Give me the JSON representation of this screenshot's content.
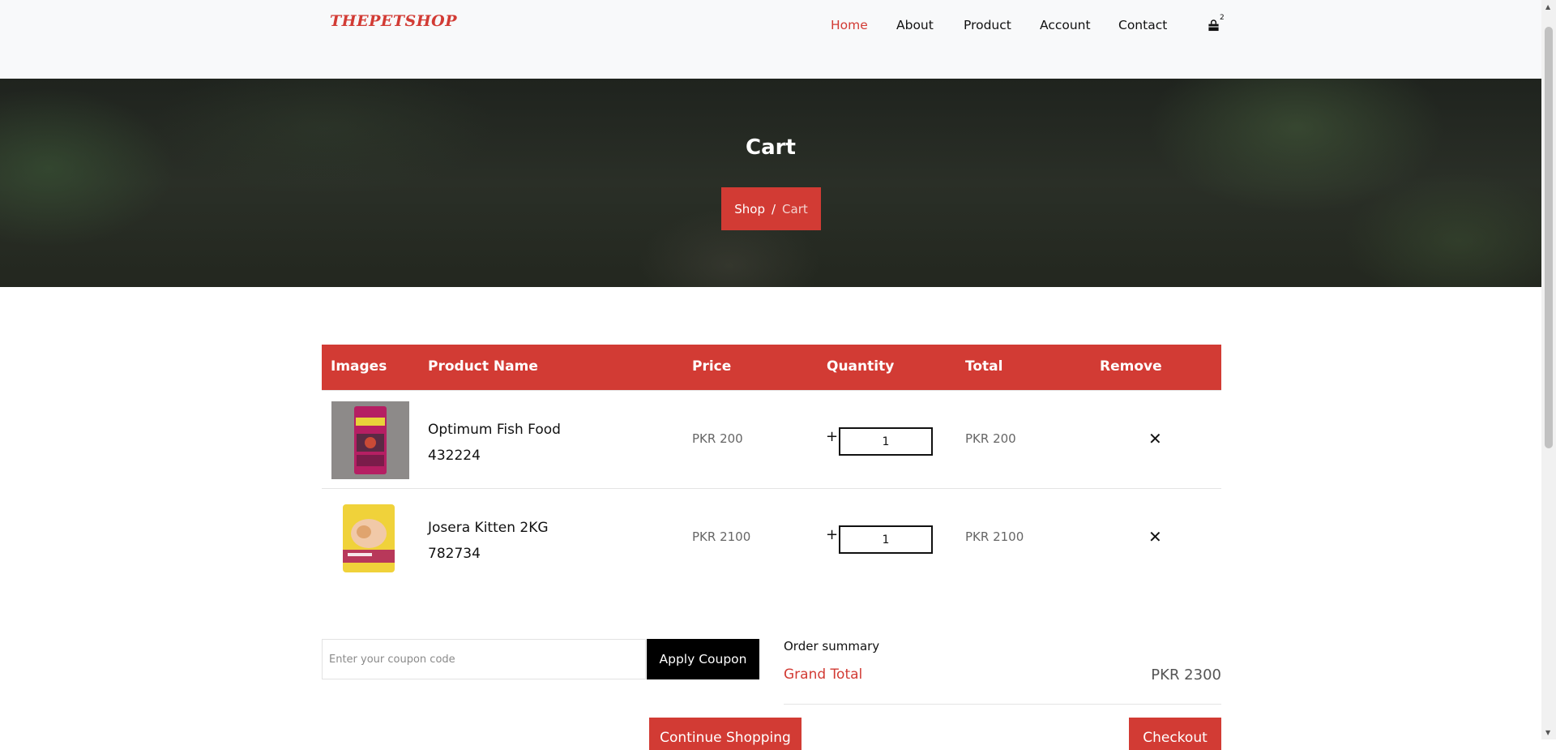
{
  "header": {
    "logo": "THEPETSHOP",
    "nav": [
      {
        "label": "Home",
        "active": true
      },
      {
        "label": "About",
        "active": false
      },
      {
        "label": "Product",
        "active": false
      },
      {
        "label": "Account",
        "active": false
      },
      {
        "label": "Contact",
        "active": false
      }
    ],
    "cart_icon": "shopping-bag-icon",
    "cart_count": "2"
  },
  "hero": {
    "title": "Cart",
    "breadcrumb": {
      "parent": "Shop",
      "separator": "/",
      "current": "Cart"
    }
  },
  "table": {
    "headers": [
      "Images",
      "Product Name",
      "Price",
      "Quantity",
      "Total",
      "Remove"
    ],
    "rows": [
      {
        "name": "Optimum Fish Food",
        "code": "432224",
        "price": "PKR 200",
        "qty": "1",
        "total": "PKR 200",
        "remove_icon": "close-icon"
      },
      {
        "name": "Josera Kitten 2KG",
        "code": "782734",
        "price": "PKR 2100",
        "qty": "1",
        "total": "PKR 2100",
        "remove_icon": "close-icon"
      }
    ],
    "plus_symbol": "+",
    "remove_symbol": "✕"
  },
  "coupon": {
    "placeholder": "Enter your coupon code",
    "button": "Apply Coupon"
  },
  "summary": {
    "label": "Order summary",
    "grand_total_label": "Grand Total",
    "grand_total_value": "PKR 2300"
  },
  "actions": {
    "continue": "Continue Shopping",
    "checkout": "Checkout"
  },
  "colors": {
    "accent": "#d23b34",
    "dark_button": "#000000",
    "header_bg": "#f8f9fa"
  }
}
